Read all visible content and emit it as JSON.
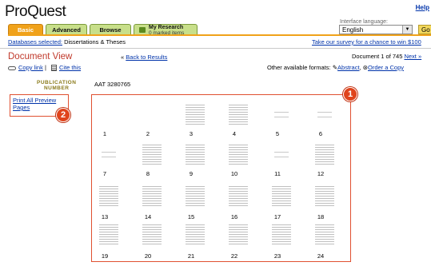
{
  "app": {
    "logo": "ProQuest",
    "help": "Help"
  },
  "interface_language": {
    "label": "Interface language:",
    "selected": "English",
    "go": "Go"
  },
  "tabs": {
    "basic": "Basic",
    "advanced": "Advanced",
    "browse": "Browse",
    "my_research": "My Research",
    "my_research_sub": "0 marked items"
  },
  "subnav": {
    "databases_link": "Databases selected:",
    "databases_value": "Dissertations & Theses"
  },
  "survey_link": "Take our survey for a chance to win $100",
  "document": {
    "title": "Document View",
    "back_link": "Back to Results",
    "back_arrows": "«",
    "doc_counter": "Document 1 of 745",
    "next_link": "Next »",
    "copy_link": "Copy link",
    "separator": "|",
    "cite_link": "Cite this",
    "formats_label": "Other available formats:",
    "abstract_link": "Abstract",
    "order_link": "Order a Copy"
  },
  "publication": {
    "label_line1": "PUBLICATION",
    "label_line2": "NUMBER",
    "value": "AAT 3280765"
  },
  "print_preview_link": "Print All Preview Pages",
  "badges": {
    "one": "1",
    "two": "2"
  },
  "pages": [
    "1",
    "2",
    "3",
    "4",
    "5",
    "6",
    "7",
    "8",
    "9",
    "10",
    "11",
    "12",
    "13",
    "14",
    "15",
    "16",
    "17",
    "18",
    "19",
    "20",
    "21",
    "22",
    "23",
    "24"
  ]
}
